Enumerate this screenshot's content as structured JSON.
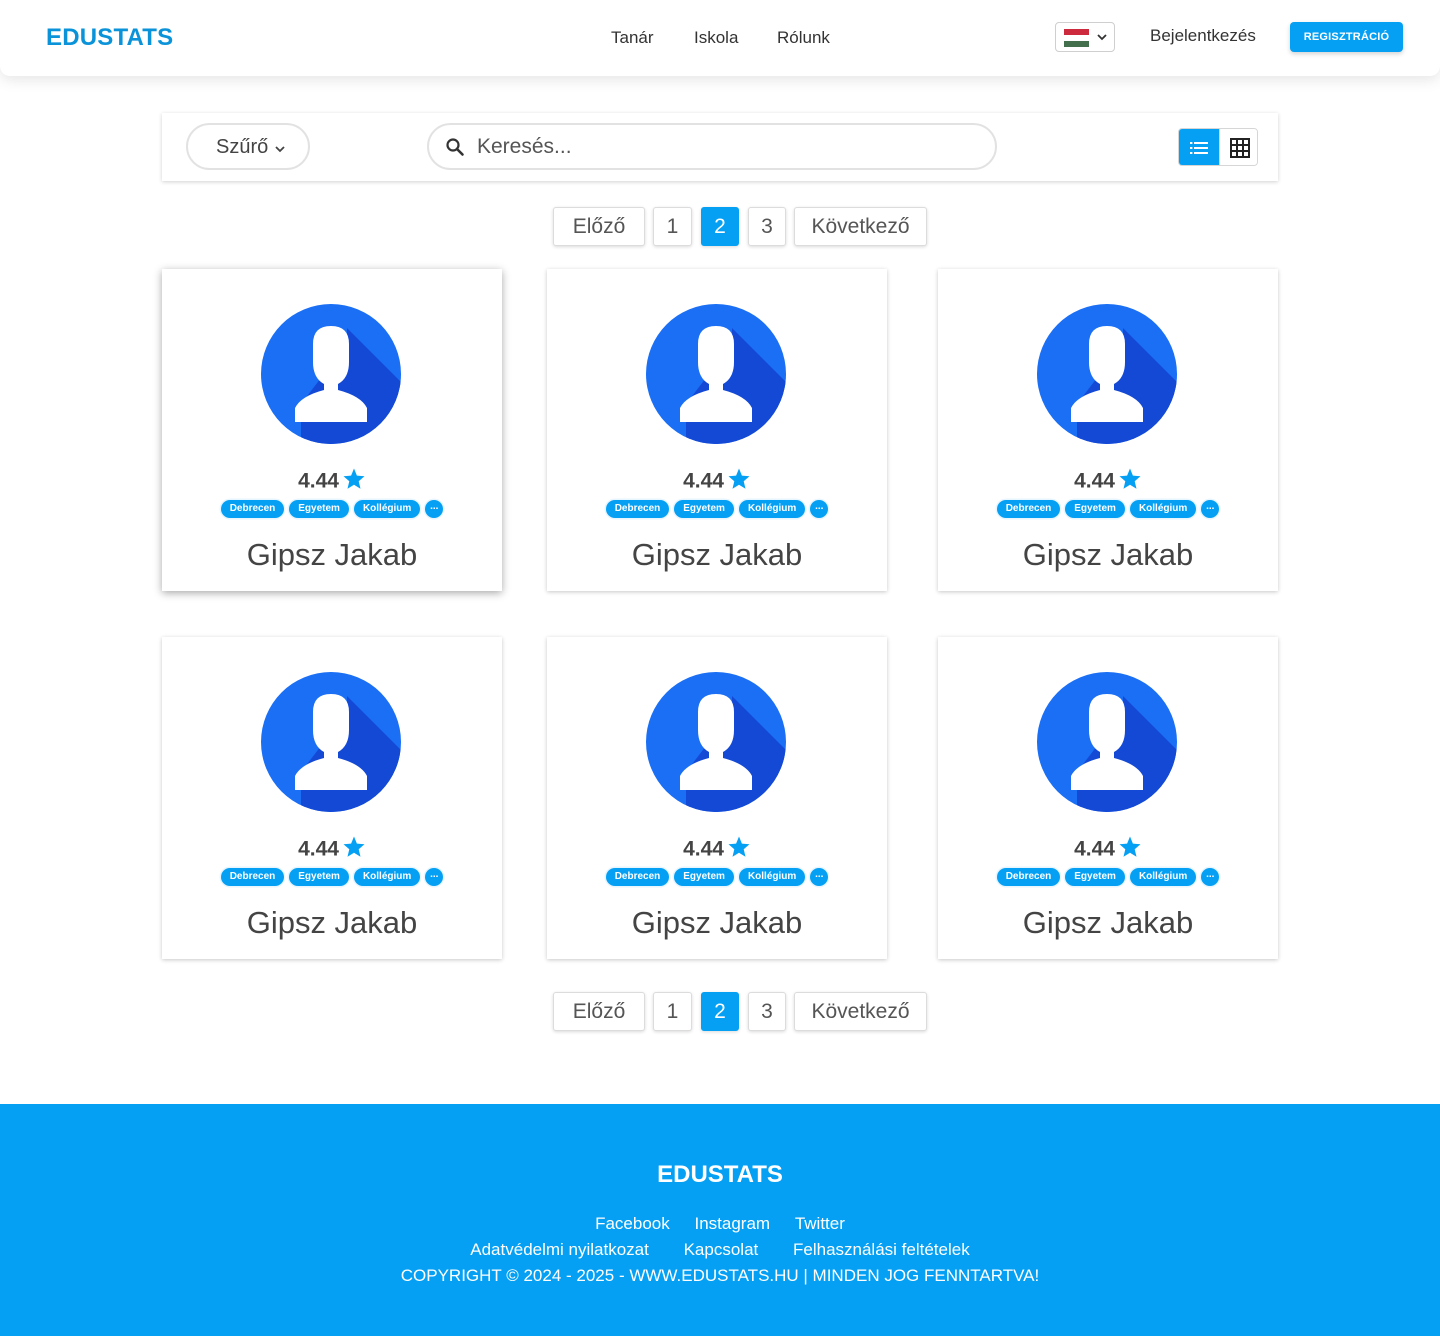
{
  "header": {
    "logo": "EDUSTATS",
    "nav": [
      "Tanár",
      "Iskola",
      "Rólunk"
    ],
    "language": "HU",
    "login_label": "Bejelentkezés",
    "register_label": "REGISZTRÁCIÓ"
  },
  "toolbar": {
    "filter_label": "Szűrő",
    "search_placeholder": "Keresés...",
    "active_view": "list"
  },
  "pagination": {
    "prev_label": "Előző",
    "pages": [
      "1",
      "2",
      "3"
    ],
    "current_page": "2",
    "next_label": "Következő"
  },
  "cards": [
    {
      "name": "Gipsz Jakab",
      "rating": "4.44",
      "tags": [
        "Debrecen",
        "Egyetem",
        "Kollégium"
      ],
      "more": "..."
    },
    {
      "name": "Gipsz Jakab",
      "rating": "4.44",
      "tags": [
        "Debrecen",
        "Egyetem",
        "Kollégium"
      ],
      "more": "..."
    },
    {
      "name": "Gipsz Jakab",
      "rating": "4.44",
      "tags": [
        "Debrecen",
        "Egyetem",
        "Kollégium"
      ],
      "more": "..."
    },
    {
      "name": "Gipsz Jakab",
      "rating": "4.44",
      "tags": [
        "Debrecen",
        "Egyetem",
        "Kollégium"
      ],
      "more": "..."
    },
    {
      "name": "Gipsz Jakab",
      "rating": "4.44",
      "tags": [
        "Debrecen",
        "Egyetem",
        "Kollégium"
      ],
      "more": "..."
    },
    {
      "name": "Gipsz Jakab",
      "rating": "4.44",
      "tags": [
        "Debrecen",
        "Egyetem",
        "Kollégium"
      ],
      "more": "..."
    }
  ],
  "footer": {
    "logo": "EDUSTATS",
    "social": [
      "Facebook",
      "Instagram",
      "Twitter"
    ],
    "links": [
      "Adatvédelmi nyilatkozat",
      "Kapcsolat",
      "Felhasználási feltételek"
    ],
    "copyright": "COPYRIGHT © 2024 - 2025 - WWW.EDUSTATS.HU | MINDEN JOG FENNTARTVA!"
  },
  "colors": {
    "accent": "#05a0f4",
    "logo": "#0a93d9",
    "avatar_blue": "#1a6ff5",
    "avatar_shadow": "#1449d6"
  },
  "icons": {
    "filter_chevron": "chevron-down-icon",
    "search": "search-icon",
    "list_view": "list-view-icon",
    "grid_view": "grid-view-icon",
    "rating": "star-icon",
    "avatar": "user-avatar-icon",
    "flag": "hungary-flag-icon"
  }
}
